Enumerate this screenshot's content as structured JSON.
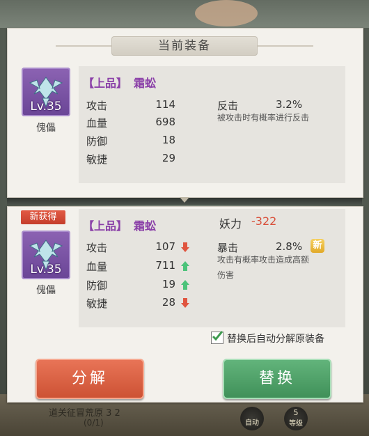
{
  "title": "当前装备",
  "current": {
    "quality_tag": "【上品】",
    "item_name": "霜蚣",
    "level": "Lv.35",
    "category": "傀儡",
    "stats": [
      {
        "label": "攻击",
        "value": "114"
      },
      {
        "label": "血量",
        "value": "698"
      },
      {
        "label": "防御",
        "value": "18"
      },
      {
        "label": "敏捷",
        "value": "29"
      }
    ],
    "special": {
      "name": "反击",
      "value": "3.2%",
      "desc": "被攻击时有概率进行反击"
    }
  },
  "new_item": {
    "badge": "新获得",
    "quality_tag": "【上品】",
    "item_name": "霜蚣",
    "level": "Lv.35",
    "category": "傀儡",
    "power_label": "妖力",
    "power_value": "-322",
    "stats": [
      {
        "label": "攻击",
        "value": "107",
        "trend": "down"
      },
      {
        "label": "血量",
        "value": "711",
        "trend": "up"
      },
      {
        "label": "防御",
        "value": "19",
        "trend": "up"
      },
      {
        "label": "敏捷",
        "value": "28",
        "trend": "down"
      }
    ],
    "special": {
      "name": "暴击",
      "value": "2.8%",
      "badge": "新",
      "desc_line1": "攻击有概率攻击造成高额",
      "desc_line2": "伤害"
    }
  },
  "auto_decompose": {
    "label": "替换后自动分解原装备",
    "checked": true
  },
  "buttons": {
    "decompose": "分解",
    "replace": "替换"
  },
  "bottom": {
    "task_text": "道关征冒荒原 3 2",
    "progress": "(0/1)",
    "auto_label": "自动",
    "level_label": "等级",
    "level_num": "5"
  },
  "colors": {
    "up": "#4cc37a",
    "down": "#e0553f",
    "quality": "#8a3fa8",
    "power_delta": "#d9503b"
  }
}
